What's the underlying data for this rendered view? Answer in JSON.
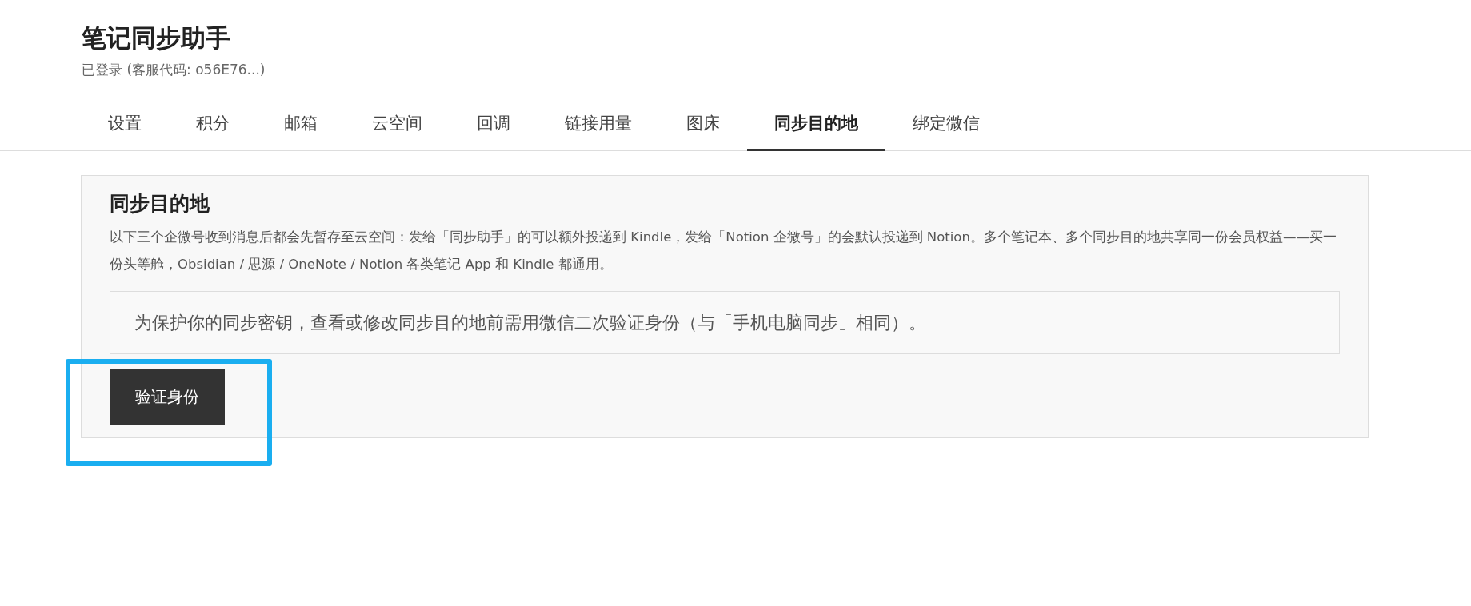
{
  "header": {
    "title": "笔记同步助手",
    "subtitle": "已登录 (客服代码: o56E76...)"
  },
  "tabs": [
    {
      "label": "设置",
      "selected": false
    },
    {
      "label": "积分",
      "selected": false
    },
    {
      "label": "邮箱",
      "selected": false
    },
    {
      "label": "云空间",
      "selected": false
    },
    {
      "label": "回调",
      "selected": false
    },
    {
      "label": "链接用量",
      "selected": false
    },
    {
      "label": "图床",
      "selected": false
    },
    {
      "label": "同步目的地",
      "selected": true
    },
    {
      "label": "绑定微信",
      "selected": false
    }
  ],
  "panel": {
    "heading": "同步目的地",
    "description": "以下三个企微号收到消息后都会先暂存至云空间：发给「同步助手」的可以额外投递到 Kindle，发给「Notion 企微号」的会默认投递到 Notion。多个笔记本、多个同步目的地共享同一份会员权益——买一份头等舱，Obsidian / 思源 / OneNote / Notion 各类笔记 App 和 Kindle 都通用。",
    "notice": "为保护你的同步密钥，查看或修改同步目的地前需用微信二次验证身份（与「手机电脑同步」相同）。",
    "button": {
      "label": "验证身份",
      "highlighted": true
    }
  }
}
